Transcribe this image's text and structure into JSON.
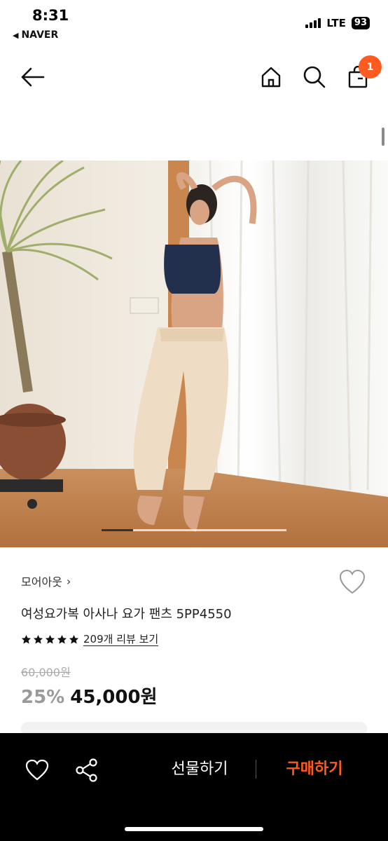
{
  "status_bar": {
    "time": "8:31",
    "back_app": "NAVER",
    "network": "LTE",
    "battery": "93"
  },
  "nav": {
    "cart_badge": "1"
  },
  "carousel": {
    "progress": 0.17
  },
  "product": {
    "brand": "모어아웃",
    "title": "여성요가복 아사나 요가 팬츠 5PP4550",
    "rating_stars": 5,
    "review_link": "209개 리뷰 보기",
    "original_price": "60,000원",
    "discount": "25%",
    "sale_price": "45,000원"
  },
  "bottom_bar": {
    "gift_label": "선물하기",
    "buy_label": "구매하기"
  },
  "colors": {
    "accent": "#ff5a1f",
    "bottom_bar_bg": "#000000",
    "price_muted": "#9a9a9a"
  },
  "icons": [
    "back-arrow-icon",
    "home-icon",
    "search-icon",
    "cart-icon",
    "heart-outline-icon",
    "star-icon",
    "share-icon"
  ]
}
